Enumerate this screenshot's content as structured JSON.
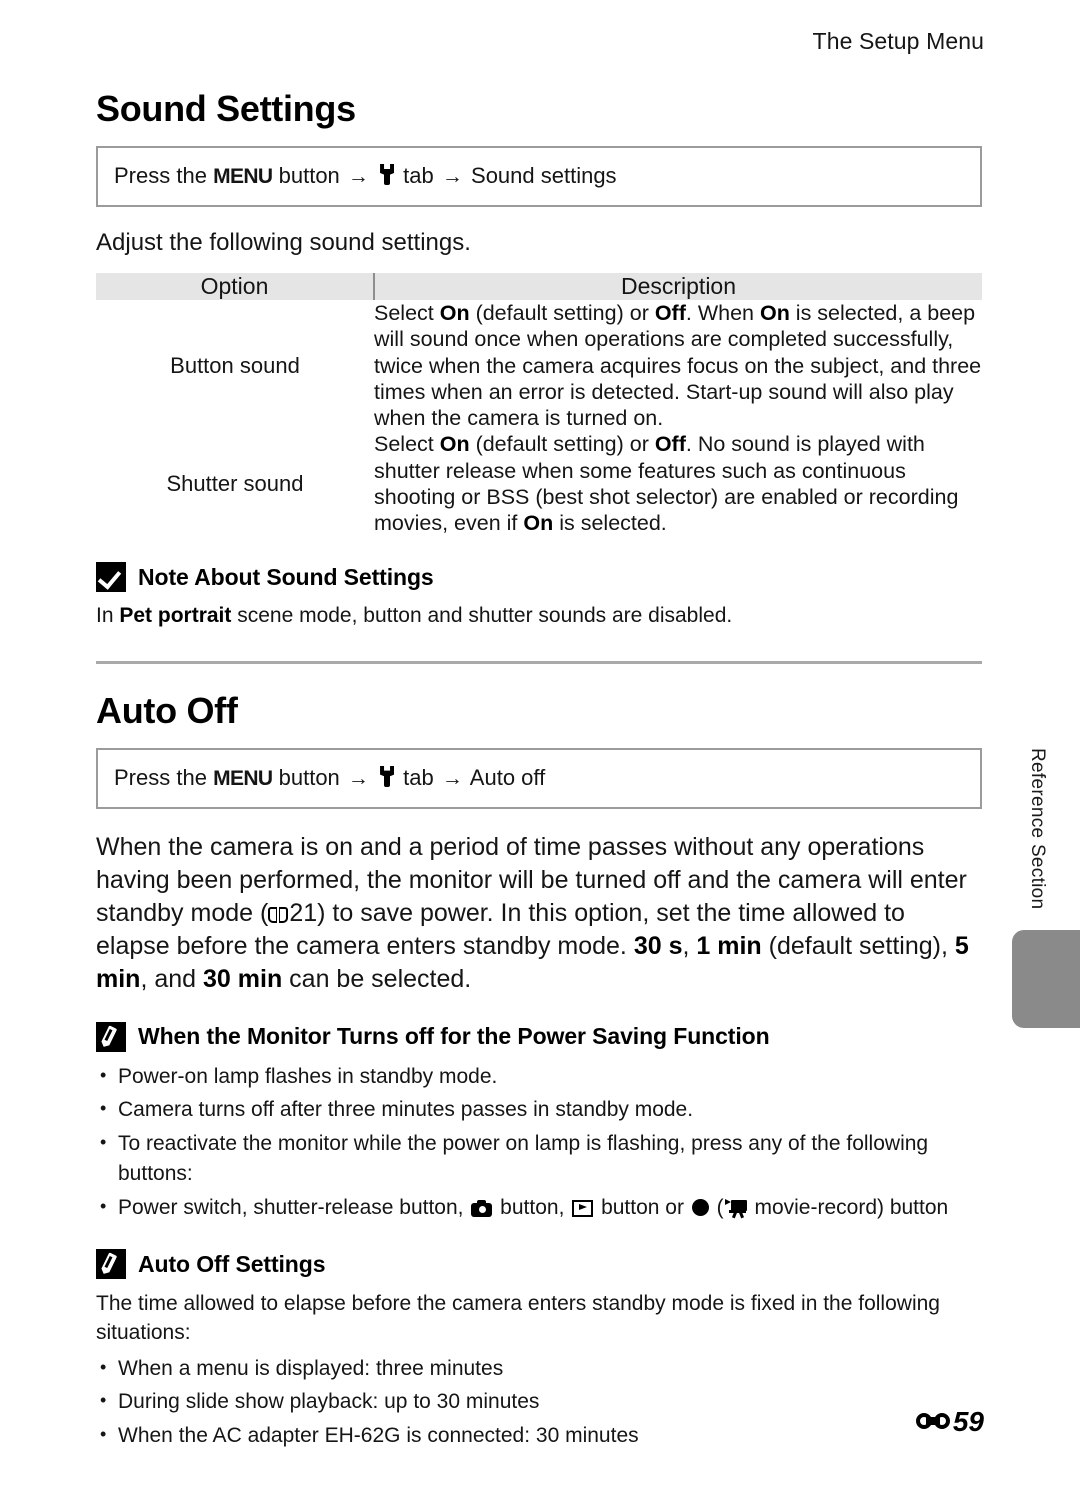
{
  "header": {
    "running_title": "The Setup Menu"
  },
  "sections": [
    {
      "title": "Sound Settings",
      "path": {
        "prefix": "Press the",
        "menu_button": "MENU",
        "button_word": "button",
        "tab_word": "tab",
        "destination": "Sound settings",
        "arrow": "→"
      },
      "intro": "Adjust the following sound settings."
    },
    {
      "title": "Auto Off",
      "path": {
        "prefix": "Press the",
        "menu_button": "MENU",
        "button_word": "button",
        "tab_word": "tab",
        "destination": "Auto off",
        "arrow": "→"
      }
    }
  ],
  "table": {
    "headers": [
      "Option",
      "Description"
    ],
    "rows": [
      {
        "option": "Button sound",
        "description_runs": [
          {
            "t": "Select "
          },
          {
            "t": "On",
            "b": true
          },
          {
            "t": " (default setting) or "
          },
          {
            "t": "Off",
            "b": true
          },
          {
            "t": ". When "
          },
          {
            "t": "On",
            "b": true
          },
          {
            "t": " is selected, a beep will sound once when operations are completed successfully, twice when the camera acquires focus on the subject, and three times when an error is detected. Start-up sound will also play when the camera is turned on."
          }
        ]
      },
      {
        "option": "Shutter sound",
        "description_runs": [
          {
            "t": "Select "
          },
          {
            "t": "On",
            "b": true
          },
          {
            "t": " (default setting) or "
          },
          {
            "t": "Off",
            "b": true
          },
          {
            "t": ". No sound is played with shutter release when some features such as continuous shooting or BSS (best shot selector) are enabled or recording movies, even if "
          },
          {
            "t": "On",
            "b": true
          },
          {
            "t": " is selected."
          }
        ]
      }
    ]
  },
  "note_sound": {
    "icon": "check-badge-icon",
    "title": "Note About Sound Settings",
    "body_runs": [
      {
        "t": "In "
      },
      {
        "t": "Pet portrait",
        "b": true
      },
      {
        "t": " scene mode, button and shutter sounds are disabled."
      }
    ]
  },
  "auto_off_body_runs": [
    {
      "t": "When the camera is on and a period of time passes without any operations having been performed, the monitor will be turned off and the camera will enter standby mode ("
    },
    {
      "t": "BOOK_ICON",
      "icon": true
    },
    {
      "t": "21) to save power. In this option, set the time allowed to elapse before the camera enters standby mode. "
    },
    {
      "t": "30 s",
      "b": true
    },
    {
      "t": ", "
    },
    {
      "t": "1 min",
      "b": true
    },
    {
      "t": " (default setting), "
    },
    {
      "t": "5 min",
      "b": true
    },
    {
      "t": ", and "
    },
    {
      "t": "30 min",
      "b": true
    },
    {
      "t": " can be selected."
    }
  ],
  "tip_power_saving": {
    "icon": "pencil-badge-icon",
    "title": "When the Monitor Turns off for the Power Saving Function",
    "bullets": [
      "Power-on lamp flashes in standby mode.",
      "Camera turns off after three minutes passes in standby mode.",
      "To reactivate the monitor while the power on lamp is flashing, press any of the following buttons:"
    ],
    "sub_bullet_runs": [
      {
        "t": "Power switch, shutter-release button, "
      },
      {
        "t": "CAMERA_ICON",
        "icon": true
      },
      {
        "t": " button, "
      },
      {
        "t": "PLAY_ICON",
        "icon": true
      },
      {
        "t": " button or "
      },
      {
        "t": "DOT_ICON",
        "icon": true
      },
      {
        "t": " ("
      },
      {
        "t": "MOVIE_ICON",
        "icon": true
      },
      {
        "t": " movie-record) button"
      }
    ]
  },
  "tip_auto_off": {
    "icon": "pencil-badge-icon",
    "title": "Auto Off Settings",
    "lead": "The time allowed to elapse before the camera enters standby mode is fixed in the following situations:",
    "bullets": [
      "When a menu is displayed: three minutes",
      "During slide show playback: up to 30 minutes",
      "When the AC adapter EH-62G is connected: 30 minutes"
    ]
  },
  "side_tab": {
    "label": "Reference Section"
  },
  "footer": {
    "page_number": "59",
    "mark": "E"
  }
}
